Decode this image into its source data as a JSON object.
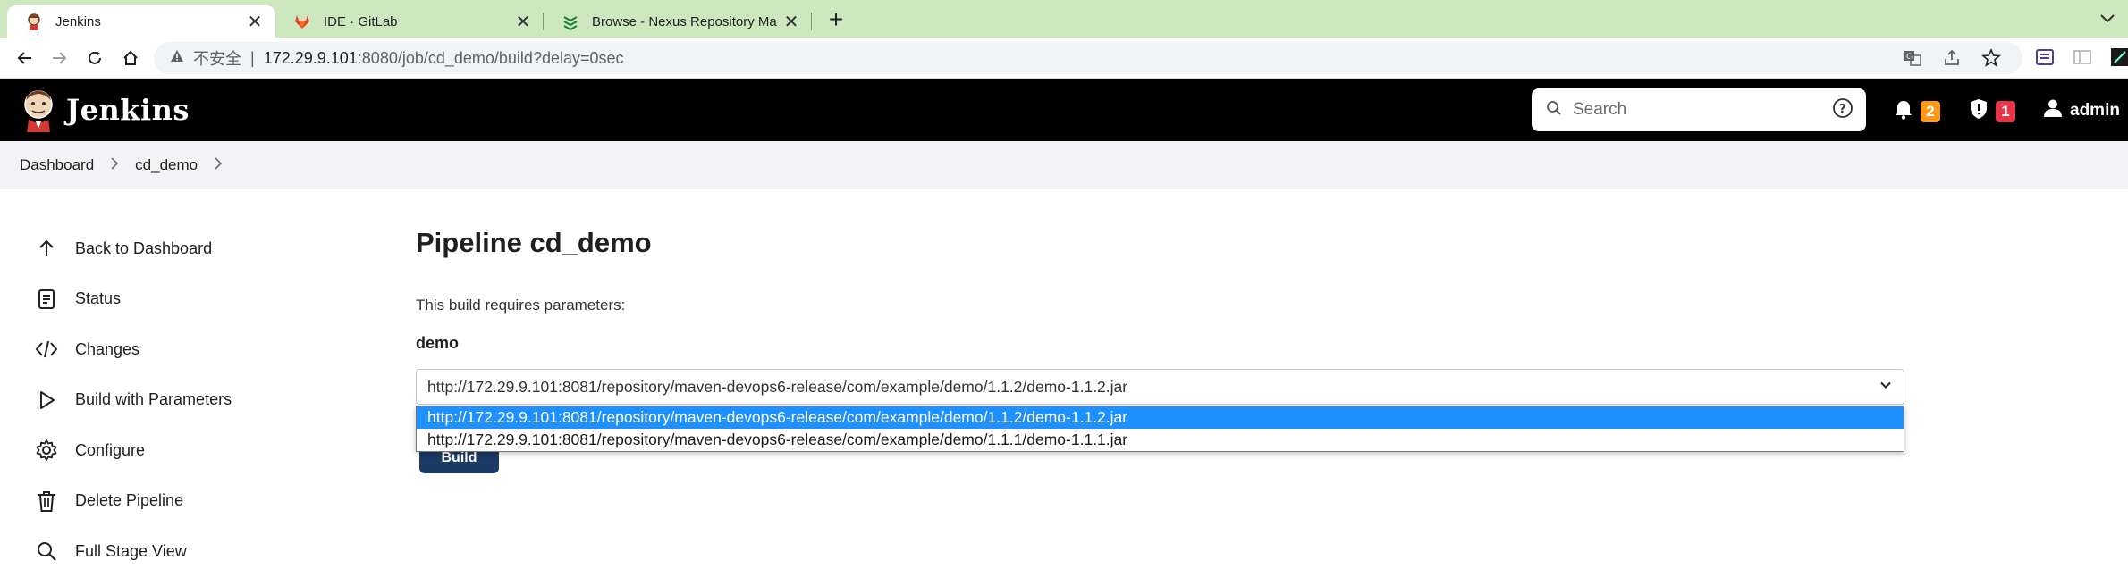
{
  "browser": {
    "tabs": [
      {
        "title": "Jenkins",
        "active": true,
        "icon": "jenkins-icon"
      },
      {
        "title": "IDE · GitLab",
        "active": false,
        "icon": "gitlab-icon"
      },
      {
        "title": "Browse - Nexus Repository Ma",
        "active": false,
        "icon": "nexus-icon"
      }
    ],
    "new_tab": "+",
    "url": {
      "security_label": "不安全",
      "separator": "|",
      "host": "172.29.9.101",
      "rest": ":8080/job/cd_demo/build?delay=0sec"
    }
  },
  "jenkins": {
    "app_name": "Jenkins",
    "search_placeholder": "Search",
    "notifications_count": "2",
    "security_count": "1",
    "user": "admin"
  },
  "breadcrumb": [
    "Dashboard",
    "cd_demo"
  ],
  "sidebar": {
    "items": [
      {
        "label": "Back to Dashboard",
        "icon": "arrow-up-icon"
      },
      {
        "label": "Status",
        "icon": "document-icon"
      },
      {
        "label": "Changes",
        "icon": "code-icon"
      },
      {
        "label": "Build with Parameters",
        "icon": "play-icon"
      },
      {
        "label": "Configure",
        "icon": "gear-icon"
      },
      {
        "label": "Delete Pipeline",
        "icon": "trash-icon"
      },
      {
        "label": "Full Stage View",
        "icon": "search-icon"
      }
    ]
  },
  "main": {
    "title": "Pipeline cd_demo",
    "requires_text": "This build requires parameters:",
    "param_name": "demo",
    "selected_value": "http://172.29.9.101:8081/repository/maven-devops6-release/com/example/demo/1.1.2/demo-1.1.2.jar",
    "options": [
      "http://172.29.9.101:8081/repository/maven-devops6-release/com/example/demo/1.1.2/demo-1.1.2.jar",
      "http://172.29.9.101:8081/repository/maven-devops6-release/com/example/demo/1.1.1/demo-1.1.1.jar"
    ],
    "build_label": "Build"
  },
  "colors": {
    "tabstrip": "#cde8bf",
    "header": "#000000",
    "breadcrumb_bg": "#f3f2f5",
    "selected_option": "#1e90ff",
    "build_button": "#1b3a64",
    "badge_orange": "#fe9a1b",
    "badge_red": "#e6354b"
  }
}
